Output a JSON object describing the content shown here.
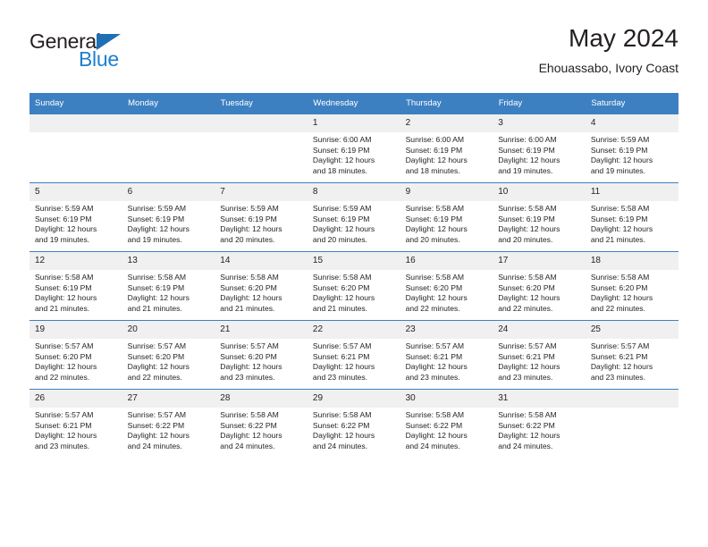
{
  "brand": {
    "name_top": "General",
    "name_bottom": "Blue",
    "triangle_icon": "brand-triangle-icon",
    "color_dark": "#231f20",
    "color_blue": "#1f7fd0"
  },
  "header": {
    "title": "May 2024",
    "subtitle": "Ehouassabo, Ivory Coast"
  },
  "theme": {
    "header_bg": "#3d80c2",
    "header_text": "#ffffff",
    "daynum_bg": "#f0f0f0",
    "body_text": "#231f20"
  },
  "weekdays": [
    "Sunday",
    "Monday",
    "Tuesday",
    "Wednesday",
    "Thursday",
    "Friday",
    "Saturday"
  ],
  "labels": {
    "sunrise": "Sunrise:",
    "sunset": "Sunset:",
    "daylight": "Daylight:"
  },
  "weeks": [
    [
      {
        "day": "",
        "blank": true
      },
      {
        "day": "",
        "blank": true
      },
      {
        "day": "",
        "blank": true
      },
      {
        "day": "1",
        "sunrise": "Sunrise: 6:00 AM",
        "sunset": "Sunset: 6:19 PM",
        "daylight_1": "Daylight: 12 hours",
        "daylight_2": "and 18 minutes."
      },
      {
        "day": "2",
        "sunrise": "Sunrise: 6:00 AM",
        "sunset": "Sunset: 6:19 PM",
        "daylight_1": "Daylight: 12 hours",
        "daylight_2": "and 18 minutes."
      },
      {
        "day": "3",
        "sunrise": "Sunrise: 6:00 AM",
        "sunset": "Sunset: 6:19 PM",
        "daylight_1": "Daylight: 12 hours",
        "daylight_2": "and 19 minutes."
      },
      {
        "day": "4",
        "sunrise": "Sunrise: 5:59 AM",
        "sunset": "Sunset: 6:19 PM",
        "daylight_1": "Daylight: 12 hours",
        "daylight_2": "and 19 minutes."
      }
    ],
    [
      {
        "day": "5",
        "sunrise": "Sunrise: 5:59 AM",
        "sunset": "Sunset: 6:19 PM",
        "daylight_1": "Daylight: 12 hours",
        "daylight_2": "and 19 minutes."
      },
      {
        "day": "6",
        "sunrise": "Sunrise: 5:59 AM",
        "sunset": "Sunset: 6:19 PM",
        "daylight_1": "Daylight: 12 hours",
        "daylight_2": "and 19 minutes."
      },
      {
        "day": "7",
        "sunrise": "Sunrise: 5:59 AM",
        "sunset": "Sunset: 6:19 PM",
        "daylight_1": "Daylight: 12 hours",
        "daylight_2": "and 20 minutes."
      },
      {
        "day": "8",
        "sunrise": "Sunrise: 5:59 AM",
        "sunset": "Sunset: 6:19 PM",
        "daylight_1": "Daylight: 12 hours",
        "daylight_2": "and 20 minutes."
      },
      {
        "day": "9",
        "sunrise": "Sunrise: 5:58 AM",
        "sunset": "Sunset: 6:19 PM",
        "daylight_1": "Daylight: 12 hours",
        "daylight_2": "and 20 minutes."
      },
      {
        "day": "10",
        "sunrise": "Sunrise: 5:58 AM",
        "sunset": "Sunset: 6:19 PM",
        "daylight_1": "Daylight: 12 hours",
        "daylight_2": "and 20 minutes."
      },
      {
        "day": "11",
        "sunrise": "Sunrise: 5:58 AM",
        "sunset": "Sunset: 6:19 PM",
        "daylight_1": "Daylight: 12 hours",
        "daylight_2": "and 21 minutes."
      }
    ],
    [
      {
        "day": "12",
        "sunrise": "Sunrise: 5:58 AM",
        "sunset": "Sunset: 6:19 PM",
        "daylight_1": "Daylight: 12 hours",
        "daylight_2": "and 21 minutes."
      },
      {
        "day": "13",
        "sunrise": "Sunrise: 5:58 AM",
        "sunset": "Sunset: 6:19 PM",
        "daylight_1": "Daylight: 12 hours",
        "daylight_2": "and 21 minutes."
      },
      {
        "day": "14",
        "sunrise": "Sunrise: 5:58 AM",
        "sunset": "Sunset: 6:20 PM",
        "daylight_1": "Daylight: 12 hours",
        "daylight_2": "and 21 minutes."
      },
      {
        "day": "15",
        "sunrise": "Sunrise: 5:58 AM",
        "sunset": "Sunset: 6:20 PM",
        "daylight_1": "Daylight: 12 hours",
        "daylight_2": "and 21 minutes."
      },
      {
        "day": "16",
        "sunrise": "Sunrise: 5:58 AM",
        "sunset": "Sunset: 6:20 PM",
        "daylight_1": "Daylight: 12 hours",
        "daylight_2": "and 22 minutes."
      },
      {
        "day": "17",
        "sunrise": "Sunrise: 5:58 AM",
        "sunset": "Sunset: 6:20 PM",
        "daylight_1": "Daylight: 12 hours",
        "daylight_2": "and 22 minutes."
      },
      {
        "day": "18",
        "sunrise": "Sunrise: 5:58 AM",
        "sunset": "Sunset: 6:20 PM",
        "daylight_1": "Daylight: 12 hours",
        "daylight_2": "and 22 minutes."
      }
    ],
    [
      {
        "day": "19",
        "sunrise": "Sunrise: 5:57 AM",
        "sunset": "Sunset: 6:20 PM",
        "daylight_1": "Daylight: 12 hours",
        "daylight_2": "and 22 minutes."
      },
      {
        "day": "20",
        "sunrise": "Sunrise: 5:57 AM",
        "sunset": "Sunset: 6:20 PM",
        "daylight_1": "Daylight: 12 hours",
        "daylight_2": "and 22 minutes."
      },
      {
        "day": "21",
        "sunrise": "Sunrise: 5:57 AM",
        "sunset": "Sunset: 6:20 PM",
        "daylight_1": "Daylight: 12 hours",
        "daylight_2": "and 23 minutes."
      },
      {
        "day": "22",
        "sunrise": "Sunrise: 5:57 AM",
        "sunset": "Sunset: 6:21 PM",
        "daylight_1": "Daylight: 12 hours",
        "daylight_2": "and 23 minutes."
      },
      {
        "day": "23",
        "sunrise": "Sunrise: 5:57 AM",
        "sunset": "Sunset: 6:21 PM",
        "daylight_1": "Daylight: 12 hours",
        "daylight_2": "and 23 minutes."
      },
      {
        "day": "24",
        "sunrise": "Sunrise: 5:57 AM",
        "sunset": "Sunset: 6:21 PM",
        "daylight_1": "Daylight: 12 hours",
        "daylight_2": "and 23 minutes."
      },
      {
        "day": "25",
        "sunrise": "Sunrise: 5:57 AM",
        "sunset": "Sunset: 6:21 PM",
        "daylight_1": "Daylight: 12 hours",
        "daylight_2": "and 23 minutes."
      }
    ],
    [
      {
        "day": "26",
        "sunrise": "Sunrise: 5:57 AM",
        "sunset": "Sunset: 6:21 PM",
        "daylight_1": "Daylight: 12 hours",
        "daylight_2": "and 23 minutes."
      },
      {
        "day": "27",
        "sunrise": "Sunrise: 5:57 AM",
        "sunset": "Sunset: 6:22 PM",
        "daylight_1": "Daylight: 12 hours",
        "daylight_2": "and 24 minutes."
      },
      {
        "day": "28",
        "sunrise": "Sunrise: 5:58 AM",
        "sunset": "Sunset: 6:22 PM",
        "daylight_1": "Daylight: 12 hours",
        "daylight_2": "and 24 minutes."
      },
      {
        "day": "29",
        "sunrise": "Sunrise: 5:58 AM",
        "sunset": "Sunset: 6:22 PM",
        "daylight_1": "Daylight: 12 hours",
        "daylight_2": "and 24 minutes."
      },
      {
        "day": "30",
        "sunrise": "Sunrise: 5:58 AM",
        "sunset": "Sunset: 6:22 PM",
        "daylight_1": "Daylight: 12 hours",
        "daylight_2": "and 24 minutes."
      },
      {
        "day": "31",
        "sunrise": "Sunrise: 5:58 AM",
        "sunset": "Sunset: 6:22 PM",
        "daylight_1": "Daylight: 12 hours",
        "daylight_2": "and 24 minutes."
      },
      {
        "day": "",
        "blank": true
      }
    ]
  ]
}
